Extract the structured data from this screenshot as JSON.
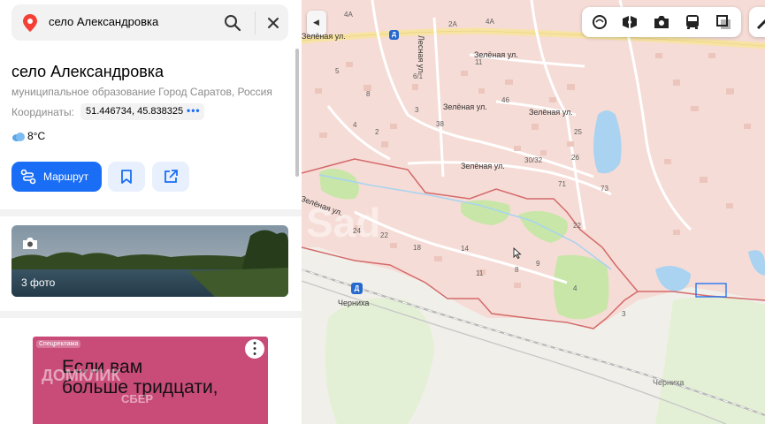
{
  "search": {
    "query": "село Александровка"
  },
  "place": {
    "title": "село Александровка",
    "subtitle": "муниципальное образование Город Саратов, Россия",
    "coords_label": "Координаты:",
    "coords_value": "51.446734, 45.838325",
    "coords_more": "•••",
    "temperature": "8°C"
  },
  "actions": {
    "route_label": "Маршрут"
  },
  "photos": {
    "count_label": "3 фото"
  },
  "ad": {
    "tag": "Спецреклама",
    "line1": "Если вам",
    "line2": "больше тридцати,",
    "brand1": "ДОМКЛИК",
    "brand2": "СБЕР",
    "colors": {
      "background": "#c94b78"
    }
  },
  "map": {
    "collapse_glyph": "◀",
    "streets": [
      "Зелёная ул.",
      "Зелёная ул.",
      "Зелёная ул.",
      "Зелёная ул.",
      "Зелёная ул.",
      "Зелёная ул.",
      "Лесная ул."
    ],
    "house_numbers": [
      "4А",
      "2А",
      "4А",
      "11",
      "5",
      "6/1",
      "8",
      "4",
      "2",
      "3",
      "38",
      "46",
      "25",
      "26",
      "30/32",
      "71",
      "73",
      "22",
      "24",
      "22",
      "18",
      "14",
      "11",
      "8",
      "9",
      "4",
      "3",
      "2А",
      "13"
    ],
    "station_name": "Черниха",
    "locality_name": "Черниха",
    "station_glyph": "Д",
    "colors": {
      "boundary": "#d46a6a",
      "settlement": "#f6dcd6",
      "water": "#a9d3f1",
      "greenery": "#c8e6a8",
      "road_yellow": "#f7e3a3",
      "accent": "#1a6ef5"
    }
  }
}
